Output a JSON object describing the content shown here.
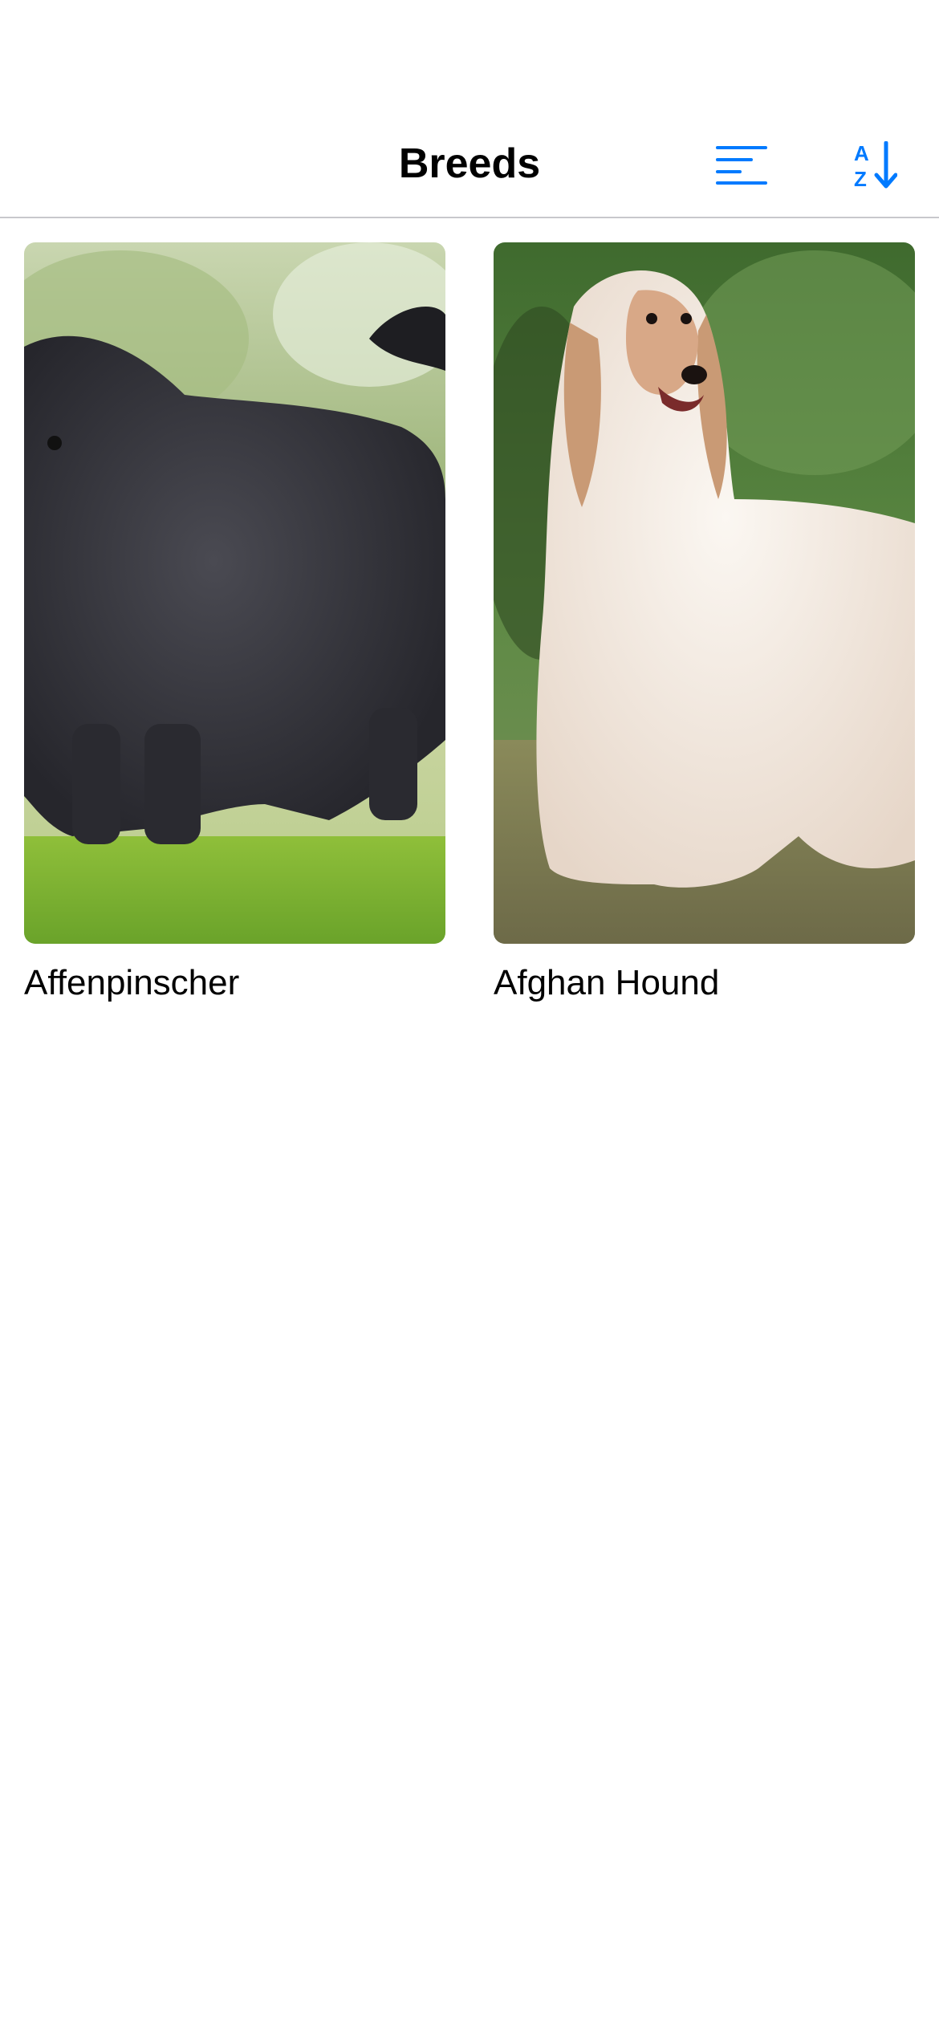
{
  "nav": {
    "title": "Breeds",
    "filter_icon": "filter-lines-icon",
    "sort_icon": "sort-az-icon"
  },
  "colors": {
    "accent": "#007AFF",
    "separator": "#C8C8CC",
    "background": "#FFFFFF",
    "text": "#000000"
  },
  "breeds": [
    {
      "name": "Affenpinscher",
      "image": "black shaggy dog standing on grass"
    },
    {
      "name": "Afghan Hound",
      "image": "long-haired cream afghan hound in forest"
    }
  ]
}
